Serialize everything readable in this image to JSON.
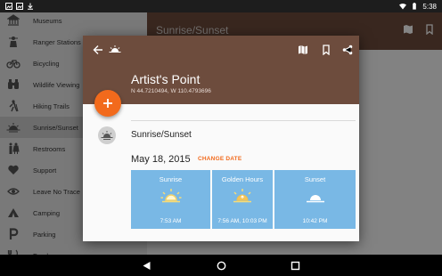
{
  "status_bar": {
    "time": "5:38"
  },
  "background": {
    "toolbar_title": "Sunrise/Sunset",
    "drawer_items": [
      {
        "label": "Museums",
        "icon": "museum-icon"
      },
      {
        "label": "Ranger Stations",
        "icon": "ranger-icon"
      },
      {
        "label": "Bicycling",
        "icon": "bicycle-icon"
      },
      {
        "label": "Wildlife Viewing",
        "icon": "binoculars-icon"
      },
      {
        "label": "Hiking Trails",
        "icon": "hiker-icon"
      },
      {
        "label": "Sunrise/Sunset",
        "icon": "sunset-icon"
      },
      {
        "label": "Restrooms",
        "icon": "restroom-icon"
      },
      {
        "label": "Support",
        "icon": "support-icon"
      },
      {
        "label": "Leave No Trace",
        "icon": "eye-icon"
      },
      {
        "label": "Camping",
        "icon": "tent-icon"
      },
      {
        "label": "Parking",
        "icon": "parking-icon"
      },
      {
        "label": "Food",
        "icon": "food-icon"
      }
    ]
  },
  "dialog": {
    "title": "Artist's Point",
    "coordinates": "N 44.7210494, W 110.4793696",
    "section_title": "Sunrise/Sunset",
    "date": "May 18, 2015",
    "change_date_label": "CHANGE DATE",
    "tiles": [
      {
        "label": "Sunrise",
        "time": "7:53 AM",
        "icon": "sunrise-icon"
      },
      {
        "label": "Golden Hours",
        "time": "7:56 AM, 10:03 PM",
        "icon": "golden-hour-icon"
      },
      {
        "label": "Sunset",
        "time": "10:42 PM",
        "icon": "sunset-icon"
      }
    ],
    "colors": {
      "header": "#6d4c3d",
      "accent": "#f26a1c",
      "tile": "#79b8e5"
    }
  },
  "nav_bar": {
    "buttons": [
      "back",
      "home",
      "recents"
    ]
  }
}
